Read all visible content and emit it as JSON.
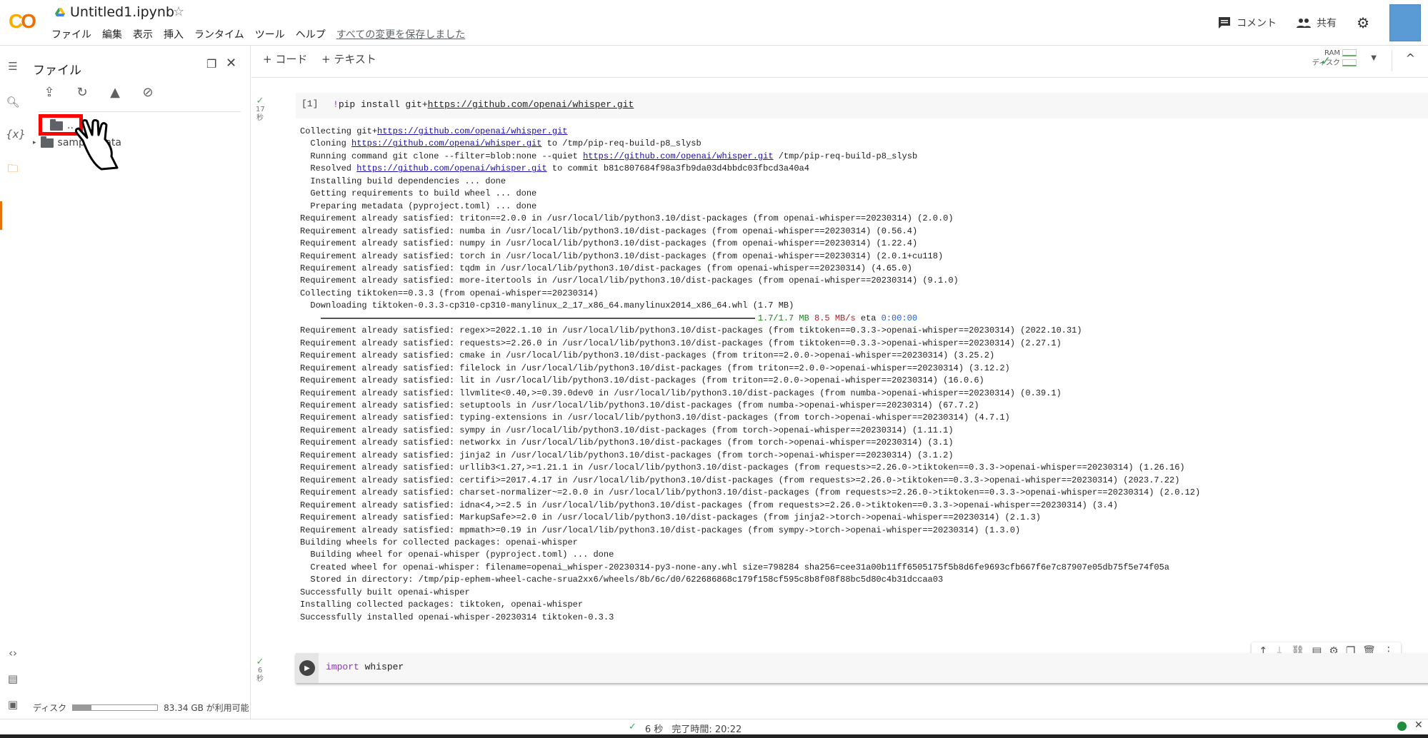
{
  "header": {
    "logo": "CO",
    "title": "Untitled1.ipynb",
    "menus": [
      "ファイル",
      "編集",
      "表示",
      "挿入",
      "ランタイム",
      "ツール",
      "ヘルプ"
    ],
    "saved_status": "すべての変更を保存しました",
    "comment_label": "コメント",
    "share_label": "共有",
    "avatar_color": "#5b9bd5"
  },
  "files_panel": {
    "title": "ファイル",
    "items": [
      {
        "label": ".."
      },
      {
        "label": "sample_data"
      }
    ],
    "disk_label": "ディスク",
    "disk_available": "83.34 GB が利用可能",
    "disk_used_fraction": 0.22
  },
  "toolbar": {
    "add_code": "+ コード",
    "add_text": "+ テキスト",
    "ram_label": "RAM",
    "disk_label": "ディスク"
  },
  "cell1": {
    "exec_count": "[1]",
    "duration": "17",
    "duration_unit": "秒",
    "code_prefix": "!",
    "code_cmd": "pip install git+",
    "code_url": "https://github.com/openai/whisper.git",
    "output": [
      [
        [
          "Collecting git+",
          ""
        ],
        [
          "https://github.com/openai/whisper.git",
          "a"
        ]
      ],
      [
        [
          "  Cloning ",
          ""
        ],
        [
          "https://github.com/openai/whisper.git",
          "a"
        ],
        [
          " to /tmp/pip-req-build-p8_slysb",
          ""
        ]
      ],
      [
        [
          "  Running command git clone --filter=blob:none --quiet ",
          ""
        ],
        [
          "https://github.com/openai/whisper.git",
          "a"
        ],
        [
          " /tmp/pip-req-build-p8_slysb",
          ""
        ]
      ],
      [
        [
          "  Resolved ",
          ""
        ],
        [
          "https://github.com/openai/whisper.git",
          "a"
        ],
        [
          " to commit b81c807684f98a3fb9da03d4bbdc03fbcd3a40a4",
          ""
        ]
      ],
      [
        [
          "  Installing build dependencies ... done",
          ""
        ]
      ],
      [
        [
          "  Getting requirements to build wheel ... done",
          ""
        ]
      ],
      [
        [
          "  Preparing metadata (pyproject.toml) ... done",
          ""
        ]
      ],
      [
        [
          "Requirement already satisfied: triton==2.0.0 in /usr/local/lib/python3.10/dist-packages (from openai-whisper==20230314) (2.0.0)",
          ""
        ]
      ],
      [
        [
          "Requirement already satisfied: numba in /usr/local/lib/python3.10/dist-packages (from openai-whisper==20230314) (0.56.4)",
          ""
        ]
      ],
      [
        [
          "Requirement already satisfied: numpy in /usr/local/lib/python3.10/dist-packages (from openai-whisper==20230314) (1.22.4)",
          ""
        ]
      ],
      [
        [
          "Requirement already satisfied: torch in /usr/local/lib/python3.10/dist-packages (from openai-whisper==20230314) (2.0.1+cu118)",
          ""
        ]
      ],
      [
        [
          "Requirement already satisfied: tqdm in /usr/local/lib/python3.10/dist-packages (from openai-whisper==20230314) (4.65.0)",
          ""
        ]
      ],
      [
        [
          "Requirement already satisfied: more-itertools in /usr/local/lib/python3.10/dist-packages (from openai-whisper==20230314) (9.1.0)",
          ""
        ]
      ],
      [
        [
          "Collecting tiktoken==0.3.3 (from openai-whisper==20230314)",
          ""
        ]
      ],
      [
        [
          "  Downloading tiktoken-0.3.3-cp310-cp310-manylinux_2_17_x86_64.manylinux2014_x86_64.whl (1.7 MB)",
          ""
        ]
      ],
      [
        [
          "    ",
          "bar"
        ],
        [
          "1.7/1.7 MB",
          "g"
        ],
        [
          " ",
          ""
        ],
        [
          "8.5 MB/s",
          "r"
        ],
        [
          " eta ",
          ""
        ],
        [
          "0:00:00",
          "b"
        ]
      ],
      [
        [
          "Requirement already satisfied: regex>=2022.1.10 in /usr/local/lib/python3.10/dist-packages (from tiktoken==0.3.3->openai-whisper==20230314) (2022.10.31)",
          ""
        ]
      ],
      [
        [
          "Requirement already satisfied: requests>=2.26.0 in /usr/local/lib/python3.10/dist-packages (from tiktoken==0.3.3->openai-whisper==20230314) (2.27.1)",
          ""
        ]
      ],
      [
        [
          "Requirement already satisfied: cmake in /usr/local/lib/python3.10/dist-packages (from triton==2.0.0->openai-whisper==20230314) (3.25.2)",
          ""
        ]
      ],
      [
        [
          "Requirement already satisfied: filelock in /usr/local/lib/python3.10/dist-packages (from triton==2.0.0->openai-whisper==20230314) (3.12.2)",
          ""
        ]
      ],
      [
        [
          "Requirement already satisfied: lit in /usr/local/lib/python3.10/dist-packages (from triton==2.0.0->openai-whisper==20230314) (16.0.6)",
          ""
        ]
      ],
      [
        [
          "Requirement already satisfied: llvmlite<0.40,>=0.39.0dev0 in /usr/local/lib/python3.10/dist-packages (from numba->openai-whisper==20230314) (0.39.1)",
          ""
        ]
      ],
      [
        [
          "Requirement already satisfied: setuptools in /usr/local/lib/python3.10/dist-packages (from numba->openai-whisper==20230314) (67.7.2)",
          ""
        ]
      ],
      [
        [
          "Requirement already satisfied: typing-extensions in /usr/local/lib/python3.10/dist-packages (from torch->openai-whisper==20230314) (4.7.1)",
          ""
        ]
      ],
      [
        [
          "Requirement already satisfied: sympy in /usr/local/lib/python3.10/dist-packages (from torch->openai-whisper==20230314) (1.11.1)",
          ""
        ]
      ],
      [
        [
          "Requirement already satisfied: networkx in /usr/local/lib/python3.10/dist-packages (from torch->openai-whisper==20230314) (3.1)",
          ""
        ]
      ],
      [
        [
          "Requirement already satisfied: jinja2 in /usr/local/lib/python3.10/dist-packages (from torch->openai-whisper==20230314) (3.1.2)",
          ""
        ]
      ],
      [
        [
          "Requirement already satisfied: urllib3<1.27,>=1.21.1 in /usr/local/lib/python3.10/dist-packages (from requests>=2.26.0->tiktoken==0.3.3->openai-whisper==20230314) (1.26.16)",
          ""
        ]
      ],
      [
        [
          "Requirement already satisfied: certifi>=2017.4.17 in /usr/local/lib/python3.10/dist-packages (from requests>=2.26.0->tiktoken==0.3.3->openai-whisper==20230314) (2023.7.22)",
          ""
        ]
      ],
      [
        [
          "Requirement already satisfied: charset-normalizer~=2.0.0 in /usr/local/lib/python3.10/dist-packages (from requests>=2.26.0->tiktoken==0.3.3->openai-whisper==20230314) (2.0.12)",
          ""
        ]
      ],
      [
        [
          "Requirement already satisfied: idna<4,>=2.5 in /usr/local/lib/python3.10/dist-packages (from requests>=2.26.0->tiktoken==0.3.3->openai-whisper==20230314) (3.4)",
          ""
        ]
      ],
      [
        [
          "Requirement already satisfied: MarkupSafe>=2.0 in /usr/local/lib/python3.10/dist-packages (from jinja2->torch->openai-whisper==20230314) (2.1.3)",
          ""
        ]
      ],
      [
        [
          "Requirement already satisfied: mpmath>=0.19 in /usr/local/lib/python3.10/dist-packages (from sympy->torch->openai-whisper==20230314) (1.3.0)",
          ""
        ]
      ],
      [
        [
          "Building wheels for collected packages: openai-whisper",
          ""
        ]
      ],
      [
        [
          "  Building wheel for openai-whisper (pyproject.toml) ... done",
          ""
        ]
      ],
      [
        [
          "  Created wheel for openai-whisper: filename=openai_whisper-20230314-py3-none-any.whl size=798284 sha256=cee31a00b11ff6505175f5b8d6fe9693cfb667f6e7c87907e05db75f5e74f05a",
          ""
        ]
      ],
      [
        [
          "  Stored in directory: /tmp/pip-ephem-wheel-cache-srua2xx6/wheels/8b/6c/d0/622686868c179f158cf595c8b8f08f88bc5d80c4b31dccaa03",
          ""
        ]
      ],
      [
        [
          "Successfully built openai-whisper",
          ""
        ]
      ],
      [
        [
          "Installing collected packages: tiktoken, openai-whisper",
          ""
        ]
      ],
      [
        [
          "Successfully installed openai-whisper-20230314 tiktoken-0.3.3",
          ""
        ]
      ]
    ]
  },
  "cell2": {
    "duration": "6",
    "duration_unit": "秒",
    "keyword": "import",
    "module": " whisper"
  },
  "statusbar": {
    "duration": "6 秒",
    "completed": "完了時間: 20:22"
  }
}
